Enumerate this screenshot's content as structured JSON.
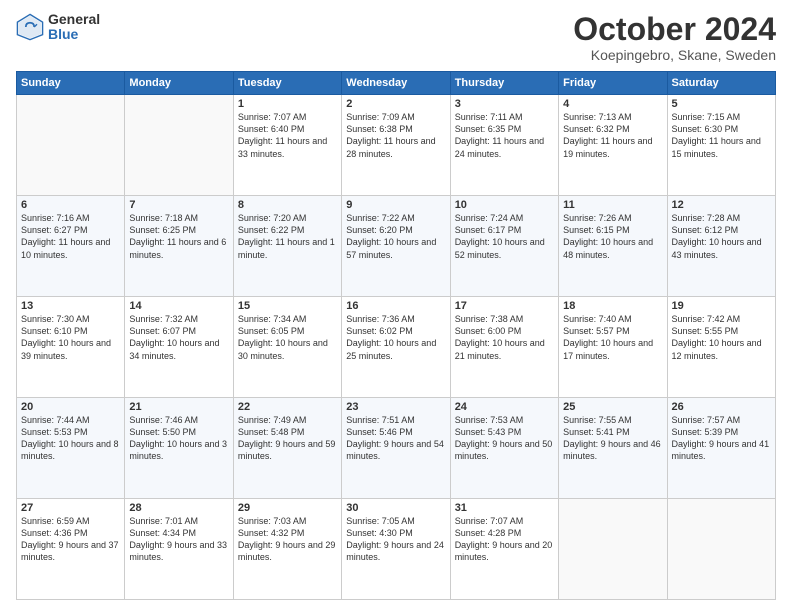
{
  "logo": {
    "general": "General",
    "blue": "Blue"
  },
  "title": "October 2024",
  "location": "Koepingebro, Skane, Sweden",
  "days_header": [
    "Sunday",
    "Monday",
    "Tuesday",
    "Wednesday",
    "Thursday",
    "Friday",
    "Saturday"
  ],
  "weeks": [
    [
      {
        "day": "",
        "sunrise": "",
        "sunset": "",
        "daylight": ""
      },
      {
        "day": "",
        "sunrise": "",
        "sunset": "",
        "daylight": ""
      },
      {
        "day": "1",
        "sunrise": "Sunrise: 7:07 AM",
        "sunset": "Sunset: 6:40 PM",
        "daylight": "Daylight: 11 hours and 33 minutes."
      },
      {
        "day": "2",
        "sunrise": "Sunrise: 7:09 AM",
        "sunset": "Sunset: 6:38 PM",
        "daylight": "Daylight: 11 hours and 28 minutes."
      },
      {
        "day": "3",
        "sunrise": "Sunrise: 7:11 AM",
        "sunset": "Sunset: 6:35 PM",
        "daylight": "Daylight: 11 hours and 24 minutes."
      },
      {
        "day": "4",
        "sunrise": "Sunrise: 7:13 AM",
        "sunset": "Sunset: 6:32 PM",
        "daylight": "Daylight: 11 hours and 19 minutes."
      },
      {
        "day": "5",
        "sunrise": "Sunrise: 7:15 AM",
        "sunset": "Sunset: 6:30 PM",
        "daylight": "Daylight: 11 hours and 15 minutes."
      }
    ],
    [
      {
        "day": "6",
        "sunrise": "Sunrise: 7:16 AM",
        "sunset": "Sunset: 6:27 PM",
        "daylight": "Daylight: 11 hours and 10 minutes."
      },
      {
        "day": "7",
        "sunrise": "Sunrise: 7:18 AM",
        "sunset": "Sunset: 6:25 PM",
        "daylight": "Daylight: 11 hours and 6 minutes."
      },
      {
        "day": "8",
        "sunrise": "Sunrise: 7:20 AM",
        "sunset": "Sunset: 6:22 PM",
        "daylight": "Daylight: 11 hours and 1 minute."
      },
      {
        "day": "9",
        "sunrise": "Sunrise: 7:22 AM",
        "sunset": "Sunset: 6:20 PM",
        "daylight": "Daylight: 10 hours and 57 minutes."
      },
      {
        "day": "10",
        "sunrise": "Sunrise: 7:24 AM",
        "sunset": "Sunset: 6:17 PM",
        "daylight": "Daylight: 10 hours and 52 minutes."
      },
      {
        "day": "11",
        "sunrise": "Sunrise: 7:26 AM",
        "sunset": "Sunset: 6:15 PM",
        "daylight": "Daylight: 10 hours and 48 minutes."
      },
      {
        "day": "12",
        "sunrise": "Sunrise: 7:28 AM",
        "sunset": "Sunset: 6:12 PM",
        "daylight": "Daylight: 10 hours and 43 minutes."
      }
    ],
    [
      {
        "day": "13",
        "sunrise": "Sunrise: 7:30 AM",
        "sunset": "Sunset: 6:10 PM",
        "daylight": "Daylight: 10 hours and 39 minutes."
      },
      {
        "day": "14",
        "sunrise": "Sunrise: 7:32 AM",
        "sunset": "Sunset: 6:07 PM",
        "daylight": "Daylight: 10 hours and 34 minutes."
      },
      {
        "day": "15",
        "sunrise": "Sunrise: 7:34 AM",
        "sunset": "Sunset: 6:05 PM",
        "daylight": "Daylight: 10 hours and 30 minutes."
      },
      {
        "day": "16",
        "sunrise": "Sunrise: 7:36 AM",
        "sunset": "Sunset: 6:02 PM",
        "daylight": "Daylight: 10 hours and 25 minutes."
      },
      {
        "day": "17",
        "sunrise": "Sunrise: 7:38 AM",
        "sunset": "Sunset: 6:00 PM",
        "daylight": "Daylight: 10 hours and 21 minutes."
      },
      {
        "day": "18",
        "sunrise": "Sunrise: 7:40 AM",
        "sunset": "Sunset: 5:57 PM",
        "daylight": "Daylight: 10 hours and 17 minutes."
      },
      {
        "day": "19",
        "sunrise": "Sunrise: 7:42 AM",
        "sunset": "Sunset: 5:55 PM",
        "daylight": "Daylight: 10 hours and 12 minutes."
      }
    ],
    [
      {
        "day": "20",
        "sunrise": "Sunrise: 7:44 AM",
        "sunset": "Sunset: 5:53 PM",
        "daylight": "Daylight: 10 hours and 8 minutes."
      },
      {
        "day": "21",
        "sunrise": "Sunrise: 7:46 AM",
        "sunset": "Sunset: 5:50 PM",
        "daylight": "Daylight: 10 hours and 3 minutes."
      },
      {
        "day": "22",
        "sunrise": "Sunrise: 7:49 AM",
        "sunset": "Sunset: 5:48 PM",
        "daylight": "Daylight: 9 hours and 59 minutes."
      },
      {
        "day": "23",
        "sunrise": "Sunrise: 7:51 AM",
        "sunset": "Sunset: 5:46 PM",
        "daylight": "Daylight: 9 hours and 54 minutes."
      },
      {
        "day": "24",
        "sunrise": "Sunrise: 7:53 AM",
        "sunset": "Sunset: 5:43 PM",
        "daylight": "Daylight: 9 hours and 50 minutes."
      },
      {
        "day": "25",
        "sunrise": "Sunrise: 7:55 AM",
        "sunset": "Sunset: 5:41 PM",
        "daylight": "Daylight: 9 hours and 46 minutes."
      },
      {
        "day": "26",
        "sunrise": "Sunrise: 7:57 AM",
        "sunset": "Sunset: 5:39 PM",
        "daylight": "Daylight: 9 hours and 41 minutes."
      }
    ],
    [
      {
        "day": "27",
        "sunrise": "Sunrise: 6:59 AM",
        "sunset": "Sunset: 4:36 PM",
        "daylight": "Daylight: 9 hours and 37 minutes."
      },
      {
        "day": "28",
        "sunrise": "Sunrise: 7:01 AM",
        "sunset": "Sunset: 4:34 PM",
        "daylight": "Daylight: 9 hours and 33 minutes."
      },
      {
        "day": "29",
        "sunrise": "Sunrise: 7:03 AM",
        "sunset": "Sunset: 4:32 PM",
        "daylight": "Daylight: 9 hours and 29 minutes."
      },
      {
        "day": "30",
        "sunrise": "Sunrise: 7:05 AM",
        "sunset": "Sunset: 4:30 PM",
        "daylight": "Daylight: 9 hours and 24 minutes."
      },
      {
        "day": "31",
        "sunrise": "Sunrise: 7:07 AM",
        "sunset": "Sunset: 4:28 PM",
        "daylight": "Daylight: 9 hours and 20 minutes."
      },
      {
        "day": "",
        "sunrise": "",
        "sunset": "",
        "daylight": ""
      },
      {
        "day": "",
        "sunrise": "",
        "sunset": "",
        "daylight": ""
      }
    ]
  ]
}
